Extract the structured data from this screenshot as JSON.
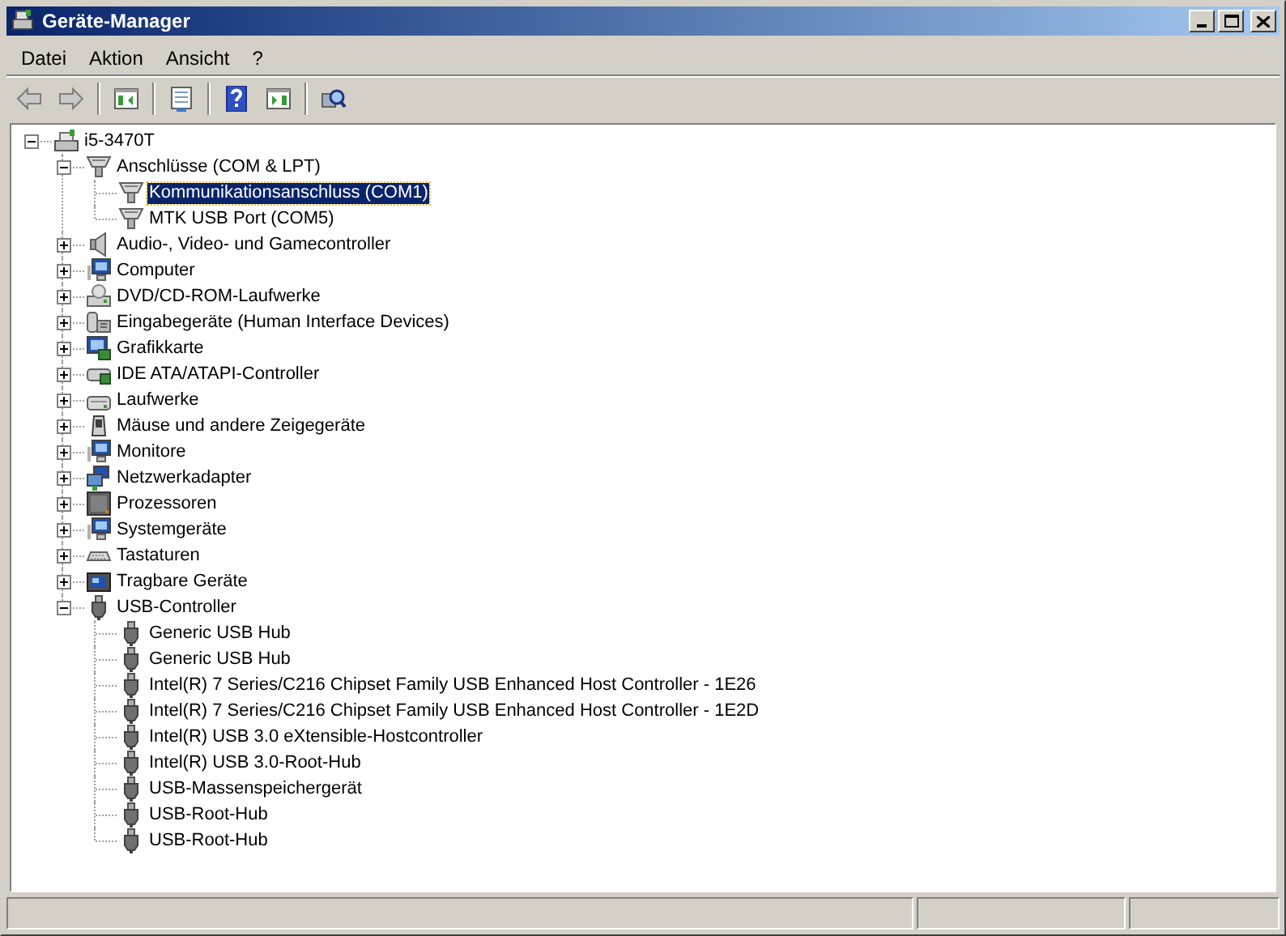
{
  "window": {
    "title": "Geräte-Manager"
  },
  "menu": [
    {
      "label": "Datei"
    },
    {
      "label": "Aktion"
    },
    {
      "label": "Ansicht"
    },
    {
      "label": "?"
    }
  ],
  "toolbar": [
    {
      "kind": "back",
      "disabled": true
    },
    {
      "kind": "forward",
      "disabled": true
    },
    {
      "kind": "sep"
    },
    {
      "kind": "tree_view",
      "disabled": false
    },
    {
      "kind": "sep"
    },
    {
      "kind": "properties",
      "disabled": false
    },
    {
      "kind": "sep"
    },
    {
      "kind": "help",
      "disabled": false
    },
    {
      "kind": "action_pane",
      "disabled": false
    },
    {
      "kind": "sep"
    },
    {
      "kind": "scan",
      "disabled": false
    }
  ],
  "tree": [
    {
      "label": "i5-3470T",
      "kind": "computer",
      "expanded": true,
      "selected": false,
      "children": [
        {
          "label": "Anschlüsse (COM & LPT)",
          "kind": "port",
          "expanded": true,
          "selected": false,
          "children": [
            {
              "label": "Kommunikationsanschluss (COM1)",
              "kind": "port",
              "selected": true
            },
            {
              "label": "MTK USB Port (COM5)",
              "kind": "port",
              "selected": false
            }
          ]
        },
        {
          "label": "Audio-, Video- und Gamecontroller",
          "kind": "audio",
          "expanded": false,
          "selected": false
        },
        {
          "label": "Computer",
          "kind": "monitor",
          "expanded": false,
          "selected": false
        },
        {
          "label": "DVD/CD-ROM-Laufwerke",
          "kind": "disc",
          "expanded": false,
          "selected": false
        },
        {
          "label": "Eingabegeräte (Human Interface Devices)",
          "kind": "input",
          "expanded": false,
          "selected": false
        },
        {
          "label": "Grafikkarte",
          "kind": "display",
          "expanded": false,
          "selected": false
        },
        {
          "label": "IDE ATA/ATAPI-Controller",
          "kind": "ide",
          "expanded": false,
          "selected": false
        },
        {
          "label": "Laufwerke",
          "kind": "drive",
          "expanded": false,
          "selected": false
        },
        {
          "label": "Mäuse und andere Zeigegeräte",
          "kind": "mouse",
          "expanded": false,
          "selected": false
        },
        {
          "label": "Monitore",
          "kind": "monitor",
          "expanded": false,
          "selected": false
        },
        {
          "label": "Netzwerkadapter",
          "kind": "network",
          "expanded": false,
          "selected": false
        },
        {
          "label": "Prozessoren",
          "kind": "cpu",
          "expanded": false,
          "selected": false
        },
        {
          "label": "Systemgeräte",
          "kind": "monitor",
          "expanded": false,
          "selected": false
        },
        {
          "label": "Tastaturen",
          "kind": "keyboard",
          "expanded": false,
          "selected": false
        },
        {
          "label": "Tragbare Geräte",
          "kind": "portable",
          "expanded": false,
          "selected": false
        },
        {
          "label": "USB-Controller",
          "kind": "usb",
          "expanded": true,
          "selected": false,
          "children": [
            {
              "label": "Generic USB Hub",
              "kind": "usb",
              "selected": false
            },
            {
              "label": "Generic USB Hub",
              "kind": "usb",
              "selected": false
            },
            {
              "label": "Intel(R) 7 Series/C216 Chipset Family USB Enhanced Host Controller - 1E26",
              "kind": "usb",
              "selected": false
            },
            {
              "label": "Intel(R) 7 Series/C216 Chipset Family USB Enhanced Host Controller - 1E2D",
              "kind": "usb",
              "selected": false
            },
            {
              "label": "Intel(R) USB 3.0 eXtensible-Hostcontroller",
              "kind": "usb",
              "selected": false
            },
            {
              "label": "Intel(R) USB 3.0-Root-Hub",
              "kind": "usb",
              "selected": false
            },
            {
              "label": "USB-Massenspeichergerät",
              "kind": "usb",
              "selected": false
            },
            {
              "label": "USB-Root-Hub",
              "kind": "usb",
              "selected": false
            },
            {
              "label": "USB-Root-Hub",
              "kind": "usb",
              "selected": false
            }
          ]
        }
      ]
    }
  ]
}
